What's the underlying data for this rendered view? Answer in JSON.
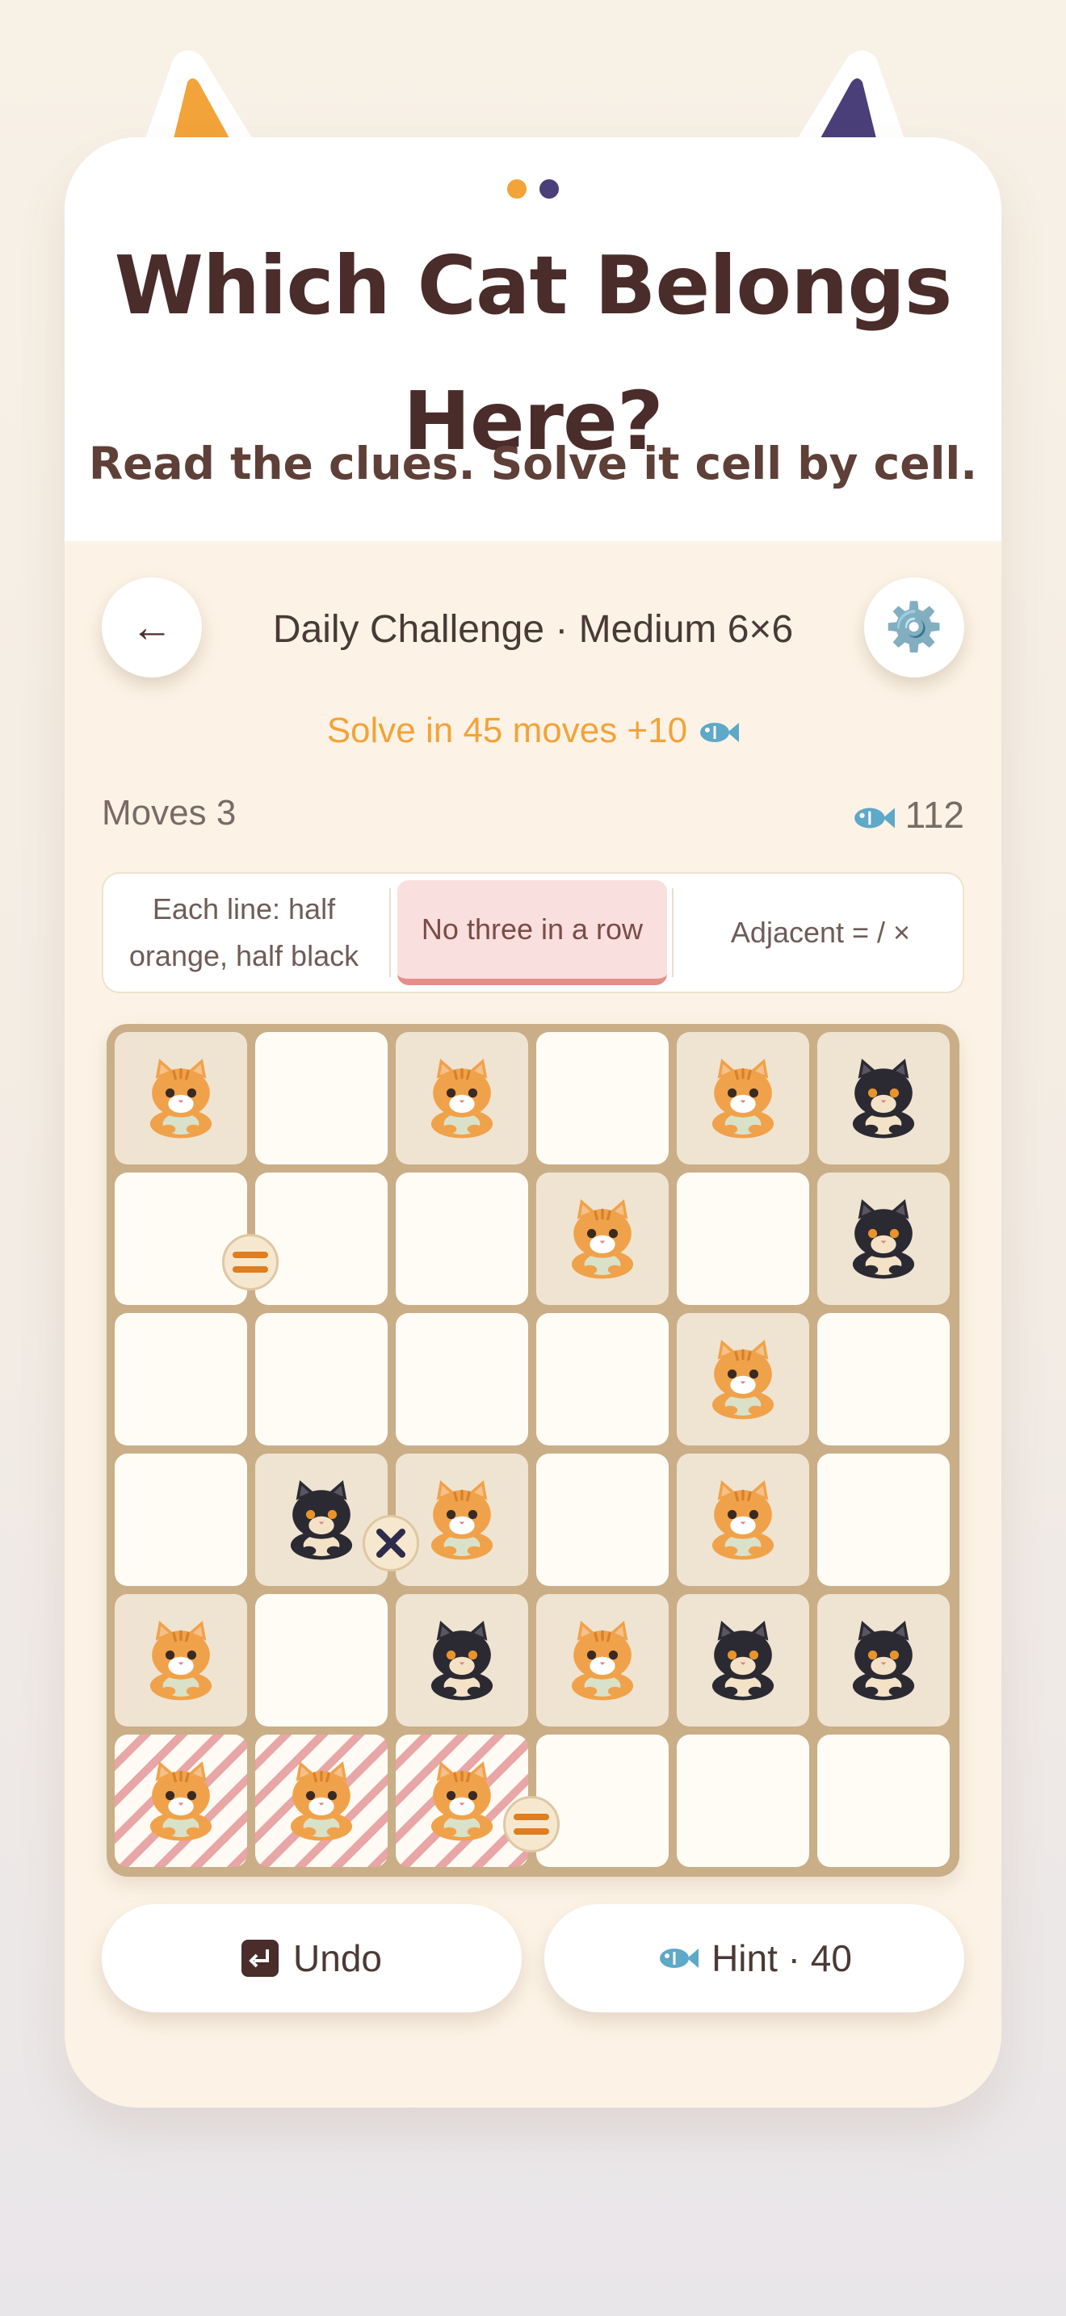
{
  "colors": {
    "orange": "#f2a33a",
    "purple": "#4b3f7a",
    "title": "#4a2c2a",
    "board": "#c9ae87",
    "conflict_stripe": "#e8a6a6"
  },
  "header": {
    "title": "Which Cat Belongs Here?",
    "subtitle": "Read the clues. Solve it cell by cell."
  },
  "topbar": {
    "back_icon": "←",
    "mode": "Daily Challenge · Medium 6×6",
    "settings_icon": "⚙️"
  },
  "reward": {
    "text": "Solve in 45 moves +10"
  },
  "stats": {
    "moves_label": "Moves 3",
    "coins": "112"
  },
  "rules": [
    {
      "label": "Each line: half orange, half black",
      "active": false
    },
    {
      "label": "No three in a row",
      "active": true
    },
    {
      "label": "Adjacent = / ×",
      "active": false
    }
  ],
  "board": {
    "size": 6,
    "cells": [
      [
        "orange",
        "empty",
        "orange",
        "empty",
        "orange",
        "black"
      ],
      [
        "empty",
        "empty",
        "empty",
        "orange",
        "empty",
        "black"
      ],
      [
        "empty",
        "empty",
        "empty",
        "empty",
        "orange",
        "empty"
      ],
      [
        "empty",
        "black",
        "orange",
        "empty",
        "orange",
        "empty"
      ],
      [
        "orange",
        "empty",
        "black",
        "orange",
        "black",
        "black"
      ],
      [
        "orange-conflict",
        "orange-conflict",
        "orange-conflict",
        "empty",
        "empty",
        "empty"
      ]
    ],
    "clues": [
      {
        "type": "=",
        "between": [
          [
            1,
            0
          ],
          [
            1,
            1
          ]
        ]
      },
      {
        "type": "×",
        "between": [
          [
            3,
            1
          ],
          [
            3,
            2
          ]
        ]
      },
      {
        "type": "=",
        "between": [
          [
            5,
            2
          ],
          [
            5,
            3
          ]
        ]
      }
    ]
  },
  "actions": {
    "undo_label": "Undo",
    "hint_label": "Hint · 40"
  }
}
